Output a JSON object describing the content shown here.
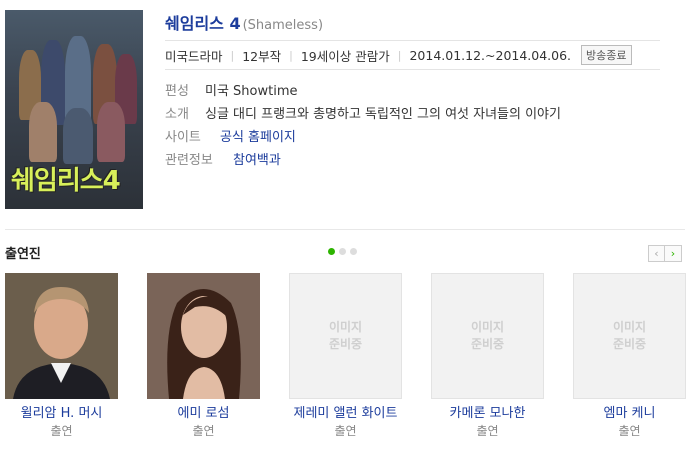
{
  "show": {
    "title": "쉐임리스 4",
    "original_title": "(Shameless)",
    "poster_text": "쉐임리스4",
    "meta": [
      "미국드라마",
      "12부작",
      "19세이상 관람가",
      "2014.01.12.~2014.04.06."
    ],
    "status_badge": "방송종료",
    "details": [
      {
        "label": "편성",
        "value": "미국 Showtime",
        "link": false
      },
      {
        "label": "소개",
        "value": "싱글 대디 프랭크와 총명하고 독립적인 그의 여섯 자녀들의 이야기",
        "link": false
      },
      {
        "label": "사이트",
        "value": "공식 홈페이지",
        "link": true
      },
      {
        "label": "관련정보",
        "value": "참여백과",
        "link": true
      }
    ]
  },
  "cast_section": {
    "header": "출연진",
    "prev_label": "‹",
    "next_label": "›",
    "page_dots": 3,
    "active_dot": 0,
    "members": [
      {
        "name": "윌리암 H. 머시",
        "role": "출연",
        "photo": "man-portrait"
      },
      {
        "name": "에미 로섬",
        "role": "출연",
        "photo": "woman-portrait"
      },
      {
        "name": "제레미 앨런 화이트",
        "role": "출연",
        "photo": "placeholder"
      },
      {
        "name": "카메론 모나한",
        "role": "출연",
        "photo": "placeholder"
      },
      {
        "name": "엠마 케니",
        "role": "출연",
        "photo": "placeholder"
      }
    ],
    "placeholder_text": [
      "이미지",
      "준비중"
    ]
  }
}
